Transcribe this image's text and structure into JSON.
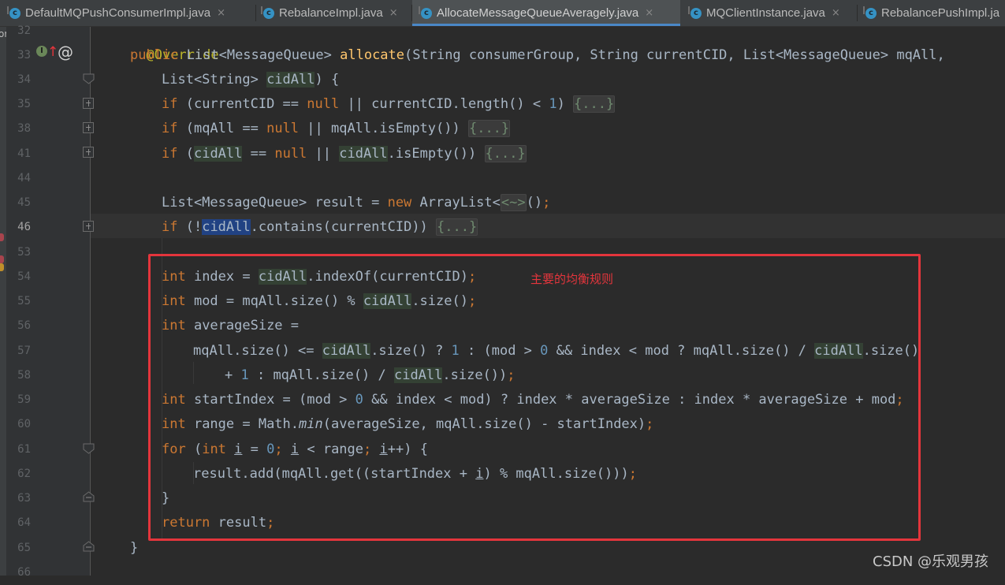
{
  "tabs": [
    {
      "label": "DefaultMQPushConsumerImpl.java",
      "close": "×",
      "active": false
    },
    {
      "label": "RebalanceImpl.java",
      "close": "×",
      "active": false
    },
    {
      "label": "AllocateMessageQueueAveragely.java",
      "close": "×",
      "active": true
    },
    {
      "label": "MQClientInstance.java",
      "close": "×",
      "active": false
    },
    {
      "label": "RebalancePushImpl.ja",
      "close": "",
      "active": false
    }
  ],
  "tab_icon_letter": "c",
  "left_strip_text": "or",
  "line_numbers": [
    "32",
    "33",
    "34",
    "35",
    "38",
    "41",
    "44",
    "45",
    "46",
    "53",
    "54",
    "55",
    "56",
    "57",
    "58",
    "59",
    "60",
    "61",
    "62",
    "63",
    "64",
    "65",
    "66"
  ],
  "current_line": "46",
  "gutter_icons": {
    "implements": "I",
    "override_arrow": "↑",
    "annotation": "@"
  },
  "annotation_note": "主要的均衡规则",
  "watermark": "CSDN @乐观男孩",
  "colors": {
    "background": "#2b2b2b",
    "keyword": "#cc7832",
    "function": "#ffc66d",
    "number": "#6897bb",
    "annotation": "#bbb529",
    "text": "#a9b7c6",
    "highlight_box": "#e4353c",
    "active_tab_underline": "#4a88c7"
  },
  "code": {
    "l32": {
      "annotation": "@Override"
    },
    "l33": {
      "k1": "public",
      "t1": " List<MessageQueue> ",
      "fn": "allocate",
      "t2": "(String consumerGroup, String currentCID, List<MessageQueue> mqAll,"
    },
    "l34": {
      "t1": "List<String> ",
      "v1": "cidAll",
      "t2": ") {"
    },
    "l35": {
      "k1": "if",
      "t1": " (currentCID == ",
      "k2": "null",
      "t2": " || currentCID.length() < ",
      "n1": "1",
      "t3": ") ",
      "ph": "{...}"
    },
    "l38": {
      "k1": "if",
      "t1": " (mqAll == ",
      "k2": "null",
      "t2": " || mqAll.isEmpty()) ",
      "ph": "{...}"
    },
    "l41": {
      "k1": "if",
      "t1": " (",
      "v1": "cidAll",
      "t2": " == ",
      "k2": "null",
      "t3": " || ",
      "v2": "cidAll",
      "t4": ".isEmpty()) ",
      "ph": "{...}"
    },
    "l45": {
      "t1": "List<MessageQueue> result = ",
      "k1": "new",
      "t2": " ArrayList<",
      "t3": "<~>",
      "t4": "()",
      "semi": ";"
    },
    "l46": {
      "k1": "if",
      "t1": " (!",
      "v1": "cidAll",
      "t2": ".contains(currentCID)) ",
      "ph": "{...}"
    },
    "l54": {
      "k1": "int",
      "t1": " index = ",
      "v1": "cidAll",
      "t2": ".indexOf(currentCID)",
      "semi": ";"
    },
    "l55": {
      "k1": "int",
      "t1": " mod = mqAll.size() % ",
      "v1": "cidAll",
      "t2": ".size()",
      "semi": ";"
    },
    "l56": {
      "k1": "int",
      "t1": " averageSize ="
    },
    "l57": {
      "t1": "mqAll.size() <= ",
      "v1": "cidAll",
      "t2": ".size() ? ",
      "n1": "1",
      "t3": " : (mod > ",
      "n2": "0",
      "t4": " && index < mod ? mqAll.size() / ",
      "v2": "cidAll",
      "t5": ".size()"
    },
    "l58": {
      "t1": "+ ",
      "n1": "1",
      "t2": " : mqAll.size() / ",
      "v1": "cidAll",
      "t3": ".size())",
      "semi": ";"
    },
    "l59": {
      "k1": "int",
      "t1": " startIndex = (mod > ",
      "n1": "0",
      "t2": " && index < mod) ? index * averageSize : index * averageSize + mod",
      "semi": ";"
    },
    "l60": {
      "k1": "int",
      "t1": " range = Math.",
      "it": "min",
      "t2": "(averageSize, mqAll.size() - startIndex)",
      "semi": ";"
    },
    "l61": {
      "k1": "for",
      "t1": " (",
      "k2": "int",
      "t2": " ",
      "u1": "i",
      "t3": " = ",
      "n1": "0",
      "s1": "; ",
      "u2": "i",
      "t4": " < range",
      "s2": "; ",
      "u3": "i",
      "t5": "++) {"
    },
    "l62": {
      "t1": "result.add(mqAll.get((startIndex + ",
      "u1": "i",
      "t2": ") % mqAll.size()))",
      "semi": ";"
    },
    "l63": {
      "t1": "}"
    },
    "l64": {
      "k1": "return",
      "t1": " result",
      "semi": ";"
    },
    "l65": {
      "t1": "}"
    }
  }
}
